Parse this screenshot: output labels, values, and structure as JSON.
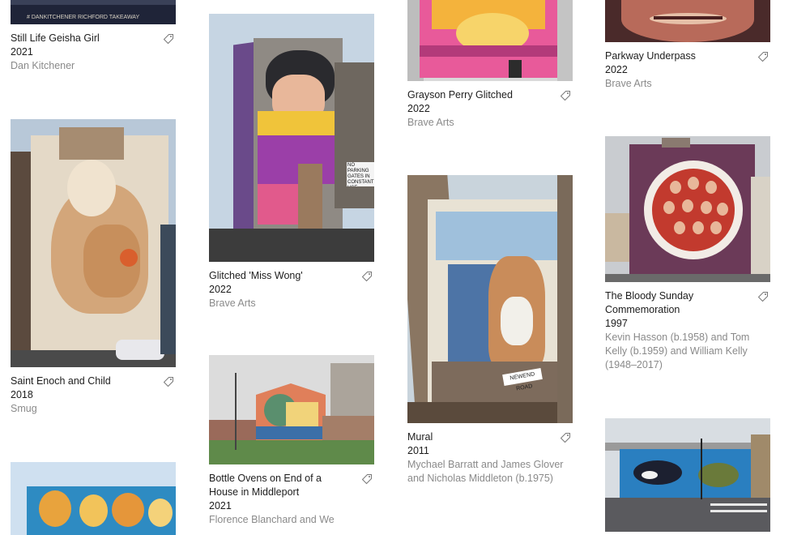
{
  "artworks": [
    {
      "title": "Still Life Geisha Girl",
      "year": "2021",
      "artist": "Dan Kitchener",
      "photo_caption": "# DANKITCHENER        RICHFORD TAKEAWAY",
      "colors": {
        "sky": "#3a3f57",
        "wall": "#1d2236",
        "accent": "#c9c3b6"
      }
    },
    {
      "title": "Saint Enoch and Child",
      "year": "2018",
      "artist": "Smug",
      "colors": {
        "sky": "#b8c8d8",
        "wall": "#e6dccb",
        "accent": "#b37a4d"
      }
    },
    {
      "title": "",
      "year": "",
      "artist": "",
      "colors": {
        "sky": "#cfe0f0",
        "wall": "#2e8bc2",
        "accent": "#e8a33d"
      }
    },
    {
      "title": "Glitched 'Miss Wong'",
      "year": "2022",
      "artist": "Brave Arts",
      "sign_text": "NO PARKING GATES IN CONSTANT USE",
      "colors": {
        "sky": "#c6d5e3",
        "wall": "#3a3d45",
        "accent": "#e15a8c"
      }
    },
    {
      "title": "Bottle Ovens on End of a House in Middleport",
      "year": "2021",
      "artist": "Florence Blanchard and We",
      "colors": {
        "sky": "#dcdcdc",
        "wall": "#5a8f6e",
        "accent": "#e07f5a"
      }
    },
    {
      "title": "Grayson Perry Glitched",
      "year": "2022",
      "artist": "Brave Arts",
      "colors": {
        "sky": "#d9d9d9",
        "wall": "#e85a9a",
        "accent": "#f4b33c"
      }
    },
    {
      "title": "Mural",
      "year": "2011",
      "artist": "Mychael Barratt and James Glover and Nicholas Middleton (b.1975)",
      "sign_text": "NEWEND ROAD",
      "colors": {
        "sky": "#c9d4dc",
        "wall": "#7d6b5c",
        "accent": "#4d74a6"
      }
    },
    {
      "title": "Parkway Underpass",
      "year": "2022",
      "artist": "Brave Arts",
      "colors": {
        "sky": "#4a2a2a",
        "wall": "#b86a5a",
        "accent": "#e6c0a8"
      }
    },
    {
      "title": "The Bloody Sunday Commemoration",
      "year": "1997",
      "artist": "Kevin Hasson (b.1958) and Tom Kelly (b.1959) and William Kelly (1948–2017)",
      "colors": {
        "sky": "#c9ccd0",
        "wall": "#6b3a58",
        "accent": "#c23a2e"
      }
    },
    {
      "title": "",
      "year": "",
      "artist": "",
      "colors": {
        "sky": "#d8dde2",
        "wall": "#2a7fc0",
        "accent": "#1c2030"
      }
    }
  ],
  "icons": {
    "tag": "tag-icon"
  }
}
